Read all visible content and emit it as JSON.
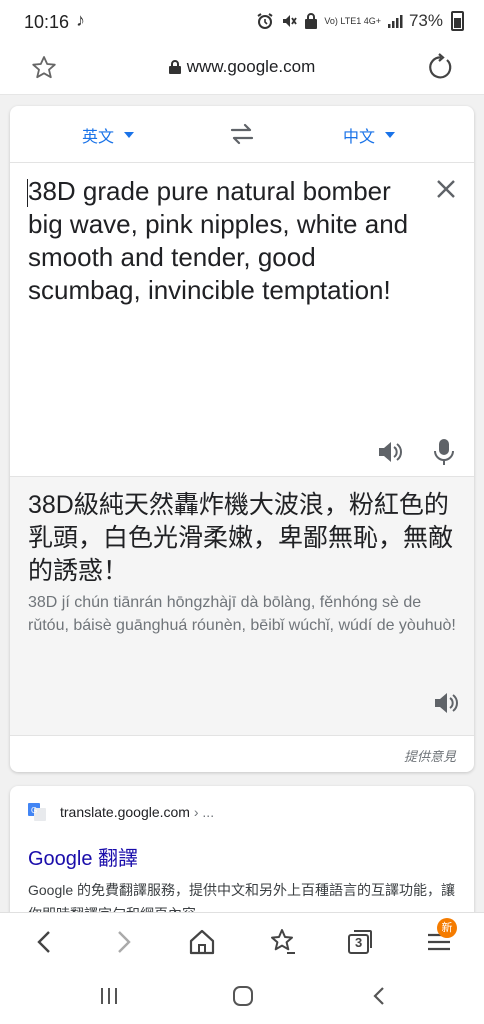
{
  "status_bar": {
    "time": "10:16",
    "music_glyph": "♪",
    "network": "Vo) LTE1 4G+",
    "battery": "73%"
  },
  "url_bar": {
    "url": "www.google.com"
  },
  "translate": {
    "source_lang": "英文",
    "target_lang": "中文",
    "source_text": "38D grade pure natural bomber big wave, pink nipples, white and smooth and tender, good scumbag, invincible temptation!",
    "translated_text": "38D級純天然轟炸機大波浪，粉紅色的乳頭，白色光滑柔嫩，卑鄙無恥，無敵的誘惑！",
    "romanization": "38D jí chún tiānrán hōngzhàjī dà bōlàng, fěnhóng sè de rǔtóu, báisè guānghuá róunèn, bēibǐ wúchǐ, wúdí de yòuhuò!",
    "feedback_label": "提供意見"
  },
  "result": {
    "site_url": "translate.google.com",
    "site_more": "› ...",
    "title": "Google 翻譯",
    "snippet": "Google 的免費翻譯服務，提供中文和另外上百種語言的互譯功能，讓你即時翻譯字句和網頁內容。"
  },
  "bottom_nav": {
    "tabs_count": "3",
    "badge": "新"
  },
  "colors": {
    "accent": "#1a73e8",
    "link": "#1a0dab",
    "badge": "#f57c00"
  }
}
